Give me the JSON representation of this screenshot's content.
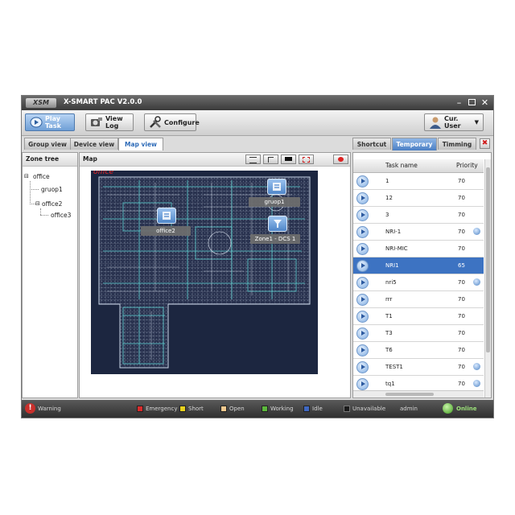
{
  "window": {
    "logo_text": "XSM",
    "title": "X-SMART PAC V2.0.0",
    "controls": [
      "minimize",
      "restore",
      "close"
    ]
  },
  "toolbar": {
    "play_task": "Play Task",
    "view_log": "View Log",
    "configure": "Configure",
    "cur_user": "Cur. User"
  },
  "left_tabs": [
    "Group view",
    "Device view",
    "Map view"
  ],
  "left_selected_tab": "Map view",
  "zone_tree": {
    "header": "Zone tree",
    "items": [
      "office",
      "gruop1",
      "office2",
      "office3"
    ]
  },
  "map": {
    "header": "Map",
    "overlay_text": "office",
    "zones": [
      "gruop1",
      "office2",
      "Zone1 - DCS 1"
    ]
  },
  "right_tabs": [
    "Shortcut",
    "Temporary",
    "Timming"
  ],
  "right_selected_tab": "Temporary",
  "task_table": {
    "columns": [
      "Task name",
      "Priority"
    ],
    "rows": [
      {
        "name": "1",
        "priority": "70",
        "repeat": false
      },
      {
        "name": "12",
        "priority": "70",
        "repeat": false
      },
      {
        "name": "3",
        "priority": "70",
        "repeat": false
      },
      {
        "name": "NRI-1",
        "priority": "70",
        "repeat": true
      },
      {
        "name": "NRI-MIC",
        "priority": "70",
        "repeat": false
      },
      {
        "name": "NRI1",
        "priority": "65",
        "repeat": false
      },
      {
        "name": "nri5",
        "priority": "70",
        "repeat": true
      },
      {
        "name": "rrr",
        "priority": "70",
        "repeat": false
      },
      {
        "name": "T1",
        "priority": "70",
        "repeat": false
      },
      {
        "name": "T3",
        "priority": "70",
        "repeat": false
      },
      {
        "name": "T6",
        "priority": "70",
        "repeat": false
      },
      {
        "name": "TEST1",
        "priority": "70",
        "repeat": true
      },
      {
        "name": "tq1",
        "priority": "70",
        "repeat": true
      }
    ],
    "selected_row": "NRI1"
  },
  "statusbar": {
    "warning": "Warning",
    "legend": [
      {
        "label": "Emergency",
        "color": "#d92b2b"
      },
      {
        "label": "Short",
        "color": "#e8d21e"
      },
      {
        "label": "Open",
        "color": "#f2c98f"
      },
      {
        "label": "Working",
        "color": "#5cb83c"
      },
      {
        "label": "Idle",
        "color": "#3f68c2"
      },
      {
        "label": "Unavailable",
        "color": "#1a1a1a"
      }
    ],
    "user": "admin",
    "connection": "Online"
  },
  "colors": {
    "accent": "#2e6bb8",
    "selected_row": "#3d73c2",
    "map_background": "#1c2640",
    "online": "#5fc43a",
    "warning": "#c9302c"
  }
}
